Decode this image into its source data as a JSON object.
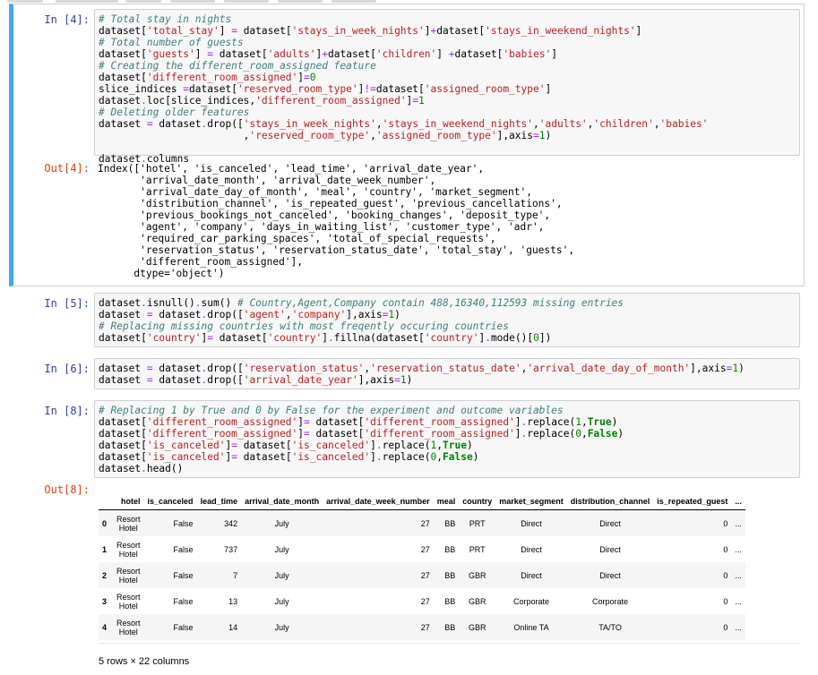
{
  "cells": {
    "c4": {
      "in_prompt": "In [4]:",
      "out_prompt": "Out[4]:",
      "output": "Index(['hotel', 'is_canceled', 'lead_time', 'arrival_date_year',\n       'arrival_date_month', 'arrival_date_week_number',\n       'arrival_date_day_of_month', 'meal', 'country', 'market_segment',\n       'distribution_channel', 'is_repeated_guest', 'previous_cancellations',\n       'previous_bookings_not_canceled', 'booking_changes', 'deposit_type',\n       'agent', 'company', 'days_in_waiting_list', 'customer_type', 'adr',\n       'required_car_parking_spaces', 'total_of_special_requests',\n       'reservation_status', 'reservation_status_date', 'total_stay', 'guests',\n       'different_room_assigned'],\n      dtype='object')"
    },
    "c5": {
      "in_prompt": "In [5]:"
    },
    "c6": {
      "in_prompt": "In [6]:"
    },
    "c8": {
      "in_prompt": "In [8]:",
      "out_prompt": "Out[8]:",
      "table": {
        "columns": [
          "",
          "hotel",
          "is_canceled",
          "lead_time",
          "arrival_date_month",
          "arrival_date_week_number",
          "meal",
          "country",
          "market_segment",
          "distribution_channel",
          "is_repeated_guest",
          "..."
        ],
        "rows": [
          [
            "0",
            "Resort Hotel",
            "False",
            "342",
            "July",
            "27",
            "BB",
            "PRT",
            "Direct",
            "Direct",
            "0",
            "..."
          ],
          [
            "1",
            "Resort Hotel",
            "False",
            "737",
            "July",
            "27",
            "BB",
            "PRT",
            "Direct",
            "Direct",
            "0",
            "..."
          ],
          [
            "2",
            "Resort Hotel",
            "False",
            "7",
            "July",
            "27",
            "BB",
            "GBR",
            "Direct",
            "Direct",
            "0",
            "..."
          ],
          [
            "3",
            "Resort Hotel",
            "False",
            "13",
            "July",
            "27",
            "BB",
            "GBR",
            "Corporate",
            "Corporate",
            "0",
            "..."
          ],
          [
            "4",
            "Resort Hotel",
            "False",
            "14",
            "July",
            "27",
            "BB",
            "GBR",
            "Online TA",
            "TA/TO",
            "0",
            "..."
          ]
        ]
      },
      "rows_note": "5 rows × 22 columns"
    }
  }
}
